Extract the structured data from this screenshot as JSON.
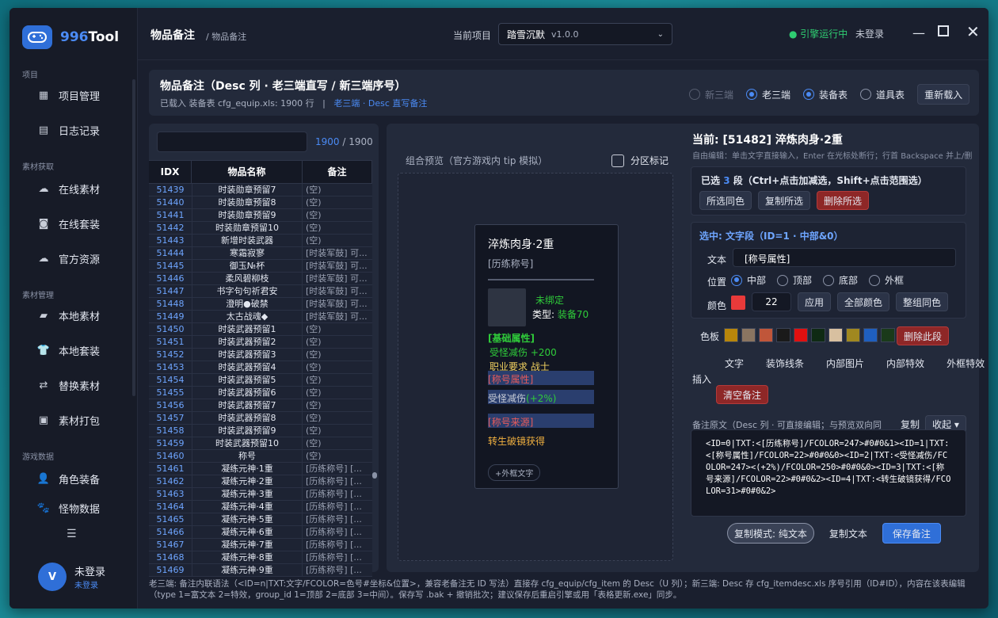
{
  "app": {
    "name_a": "996",
    "name_b": "Tool"
  },
  "sidebar": {
    "sec_project": "项目",
    "item_project": "项目管理",
    "item_log": "日志记录",
    "sec_fetch": "素材获取",
    "item_online": "在线素材",
    "item_suit": "在线套装",
    "item_official": "官方资源",
    "sec_manage": "素材管理",
    "item_local": "本地素材",
    "item_localsuit": "本地套装",
    "item_replace": "替换素材",
    "item_pack": "素材打包",
    "sec_game": "游戏数据",
    "item_equip": "角色装备",
    "item_monster": "怪物数据",
    "user_avatar": "V",
    "user_name": "未登录",
    "user_status": "未登录"
  },
  "topbar": {
    "title": "物品备注",
    "crumb": "/ 物品备注",
    "proj_label": "当前项目",
    "proj_name": "踏雪沉默",
    "proj_ver": "v1.0.0",
    "engine": "● 引擎运行中",
    "login": "未登录"
  },
  "header": {
    "title": "物品备注（Desc 列 · 老三端直写 / 新三端序号）",
    "sub": "已载入 装备表 cfg_equip.xls: 1900 行",
    "sep": "|",
    "link": "老三端 · Desc 直写备注",
    "r_new": "新三端",
    "r_old": "老三端",
    "r_equip": "装备表",
    "r_item": "道具表",
    "reload": "重新载入"
  },
  "list": {
    "count_a": "1900",
    "count_b": " / 1900",
    "h_idx": "IDX",
    "h_name": "物品名称",
    "h_note": "备注",
    "rows": [
      [
        "51439",
        "时装勋章预留7",
        "(空)"
      ],
      [
        "51440",
        "时装勋章预留8",
        "(空)"
      ],
      [
        "51441",
        "时装勋章预留9",
        "(空)"
      ],
      [
        "51442",
        "时装勋章预留10",
        "(空)"
      ],
      [
        "51443",
        "新增时装武器",
        "(空)"
      ],
      [
        "51444",
        "寒霜寂寥",
        "[时装军鼓] 可..."
      ],
      [
        "51445",
        "御玉№杯",
        "[时装军鼓] 可..."
      ],
      [
        "51446",
        "柔风碧柳枝",
        "[时装军鼓] 可..."
      ],
      [
        "51447",
        "书字句句祈君安",
        "[时装军鼓] 可..."
      ],
      [
        "51448",
        "澄明●破禁",
        "[时装军鼓] 可..."
      ],
      [
        "51449",
        "太古战魂◆",
        "[时装军鼓] 可..."
      ],
      [
        "51450",
        "时装武器预留1",
        "(空)"
      ],
      [
        "51451",
        "时装武器预留2",
        "(空)"
      ],
      [
        "51452",
        "时装武器预留3",
        "(空)"
      ],
      [
        "51453",
        "时装武器预留4",
        "(空)"
      ],
      [
        "51454",
        "时装武器预留5",
        "(空)"
      ],
      [
        "51455",
        "时装武器预留6",
        "(空)"
      ],
      [
        "51456",
        "时装武器预留7",
        "(空)"
      ],
      [
        "51457",
        "时装武器预留8",
        "(空)"
      ],
      [
        "51458",
        "时装武器预留9",
        "(空)"
      ],
      [
        "51459",
        "时装武器预留10",
        "(空)"
      ],
      [
        "51460",
        "称号",
        "(空)"
      ],
      [
        "51461",
        "凝练元神·1重",
        "[历练称号] [..."
      ],
      [
        "51462",
        "凝练元神·2重",
        "[历练称号] [..."
      ],
      [
        "51463",
        "凝练元神·3重",
        "[历练称号] [..."
      ],
      [
        "51464",
        "凝练元神·4重",
        "[历练称号] [..."
      ],
      [
        "51465",
        "凝练元神·5重",
        "[历练称号] [..."
      ],
      [
        "51466",
        "凝练元神·6重",
        "[历练称号] [..."
      ],
      [
        "51467",
        "凝练元神·7重",
        "[历练称号] [..."
      ],
      [
        "51468",
        "凝练元神·8重",
        "[历练称号] [..."
      ],
      [
        "51469",
        "凝练元神·9重",
        "[历练称号] [..."
      ]
    ]
  },
  "preview": {
    "label": "组合预览（官方游戏内 tip 模拟）",
    "check": "分区标记",
    "t1": "淬炼肉身·2重",
    "t2": "[历练称号]",
    "bind": "未绑定",
    "type_a": "类型: ",
    "type_b": "装备70",
    "base": "[基础属性]",
    "attr1": "受怪减伤 +200",
    "attr2": "职业要求 战士",
    "title_attr": "[称号属性]",
    "dmg_a": "受怪减伤",
    "dmg_b": "(+2%)",
    "src": "[称号来源]",
    "get": "转生破镜获得",
    "outer": "+外框文字"
  },
  "editor": {
    "current": "当前: [51482] 淬炼肉身·2重",
    "hint": "自由编辑：单击文字直接输入，Enter 在光标处断行；行首 Backspace 并上/删",
    "sel_a": "已选 ",
    "sel_n": "3",
    "sel_b": " 段（Ctrl+点击加减选，Shift+点击范围选）",
    "b_same": "所选同色",
    "b_copy": "复制所选",
    "b_del": "删除所选",
    "selected": "选中: 文字段（ID=1 · 中部&0）",
    "text_lbl": "文本",
    "text_val": "[称号属性]",
    "pos_lbl": "位置",
    "p_mid": "中部",
    "p_top": "顶部",
    "p_bot": "底部",
    "p_out": "外框",
    "color_lbl": "颜色",
    "color_val": "22",
    "apply": "应用",
    "all_color": "全部颜色",
    "same_color": "整组同色",
    "palette_lbl": "色板",
    "del_seg": "删除此段",
    "insert_lbl": "插入",
    "ins_text": "文字",
    "ins_line": "装饰线条",
    "ins_img": "内部图片",
    "ins_fx": "内部特效",
    "ins_ofx": "外框特效",
    "clear": "清空备注",
    "raw_lbl": "备注原文（Desc 列 · 可直接编辑；与预览双向同",
    "raw_copy": "复制",
    "collapse": "收起 ▾",
    "code": "<ID=0|TXT:<[历练称号]/FCOLOR=247>#0#0&1><ID=1|TXT:<[称号属性]/FCOLOR=22>#0#0&0><ID=2|TXT:<受怪减伤/FCOLOR=247><(+2%)/FCOLOR=250>#0#0&0><ID=3|TXT:<[称号来源]/FCOLOR=22>#0#0&2><ID=4|TXT:<转生破镜获得/FCOLOR=31>#0#0&2>",
    "mode": "复制模式: 纯文本",
    "copy_text": "复制文本",
    "save": "保存备注",
    "palette": [
      "#b8860b",
      "#8a7561",
      "#c0563a",
      "#1a1a1a",
      "#e01010",
      "#0f2a14",
      "#d8c0a0",
      "#a08820",
      "#1f5fbf",
      "#1a3a1a"
    ]
  },
  "footer": "老三端: 备注内联语法（<ID=n|TXT:文字/FCOLOR=色号#坐标&位置>，兼容老备注无 ID 写法）直接存 cfg_equip/cfg_item 的 Desc（U 列）；新三端: Desc 存 cfg_itemdesc.xls 序号引用（ID#ID），内容在该表编辑（type 1=富文本 2=特效，group_id 1=顶部 2=底部 3=中间）。保存写 .bak + 撤销批次；建议保存后重启引擎或用「表格更新.exe」同步。"
}
